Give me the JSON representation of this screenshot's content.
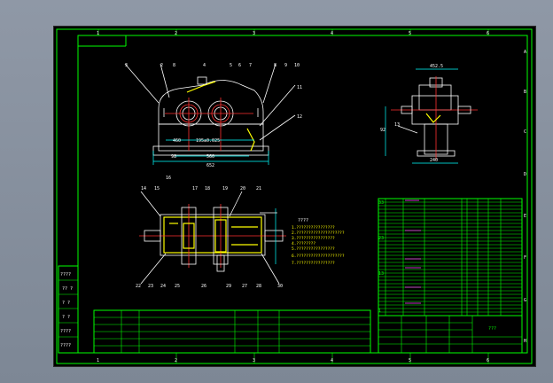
{
  "drawing": {
    "grid_columns": [
      "1",
      "2",
      "3",
      "4",
      "5",
      "6"
    ],
    "grid_rows": [
      "A",
      "B",
      "C",
      "D",
      "E",
      "F",
      "G",
      "H"
    ],
    "front_view": {
      "callouts_top": [
        "3",
        "2",
        "8",
        "4",
        "5",
        "6",
        "7",
        "8",
        "9",
        "10"
      ],
      "callouts_right": [
        "11",
        "12"
      ],
      "dims": [
        "460",
        "195±0.025",
        "98",
        "560",
        "652"
      ]
    },
    "side_view": {
      "dims": [
        "452.5",
        "92",
        "13",
        "240"
      ]
    },
    "plan_view": {
      "callouts_top": [
        "14",
        "15",
        "16",
        "17",
        "18",
        "19",
        "20",
        "21"
      ],
      "callouts_bottom": [
        "22",
        "23",
        "24",
        "25",
        "26",
        "27",
        "28",
        "29",
        "30"
      ],
      "notes_title": "????",
      "notes": [
        "1.????????????????",
        "2.????????????????????",
        "3.????????????????",
        "4.????????",
        "5.????????????????",
        "6.????????????????????",
        "7.????????????????"
      ]
    },
    "parts_list": {
      "rows": [
        "33",
        "32",
        "31",
        "30",
        "29",
        "28",
        "27",
        "26",
        "25",
        "24",
        "23",
        "22",
        "21",
        "20",
        "19",
        "18",
        "17",
        "16",
        "15",
        "14",
        "13",
        "12",
        "11",
        "10",
        "9",
        "8",
        "7",
        "6",
        "5",
        "4",
        "3",
        "2",
        "1"
      ]
    },
    "title_block": {
      "name": "???",
      "left_labels": [
        "????",
        "?? ?",
        "? ?",
        "? ?",
        "????",
        "????"
      ]
    }
  }
}
